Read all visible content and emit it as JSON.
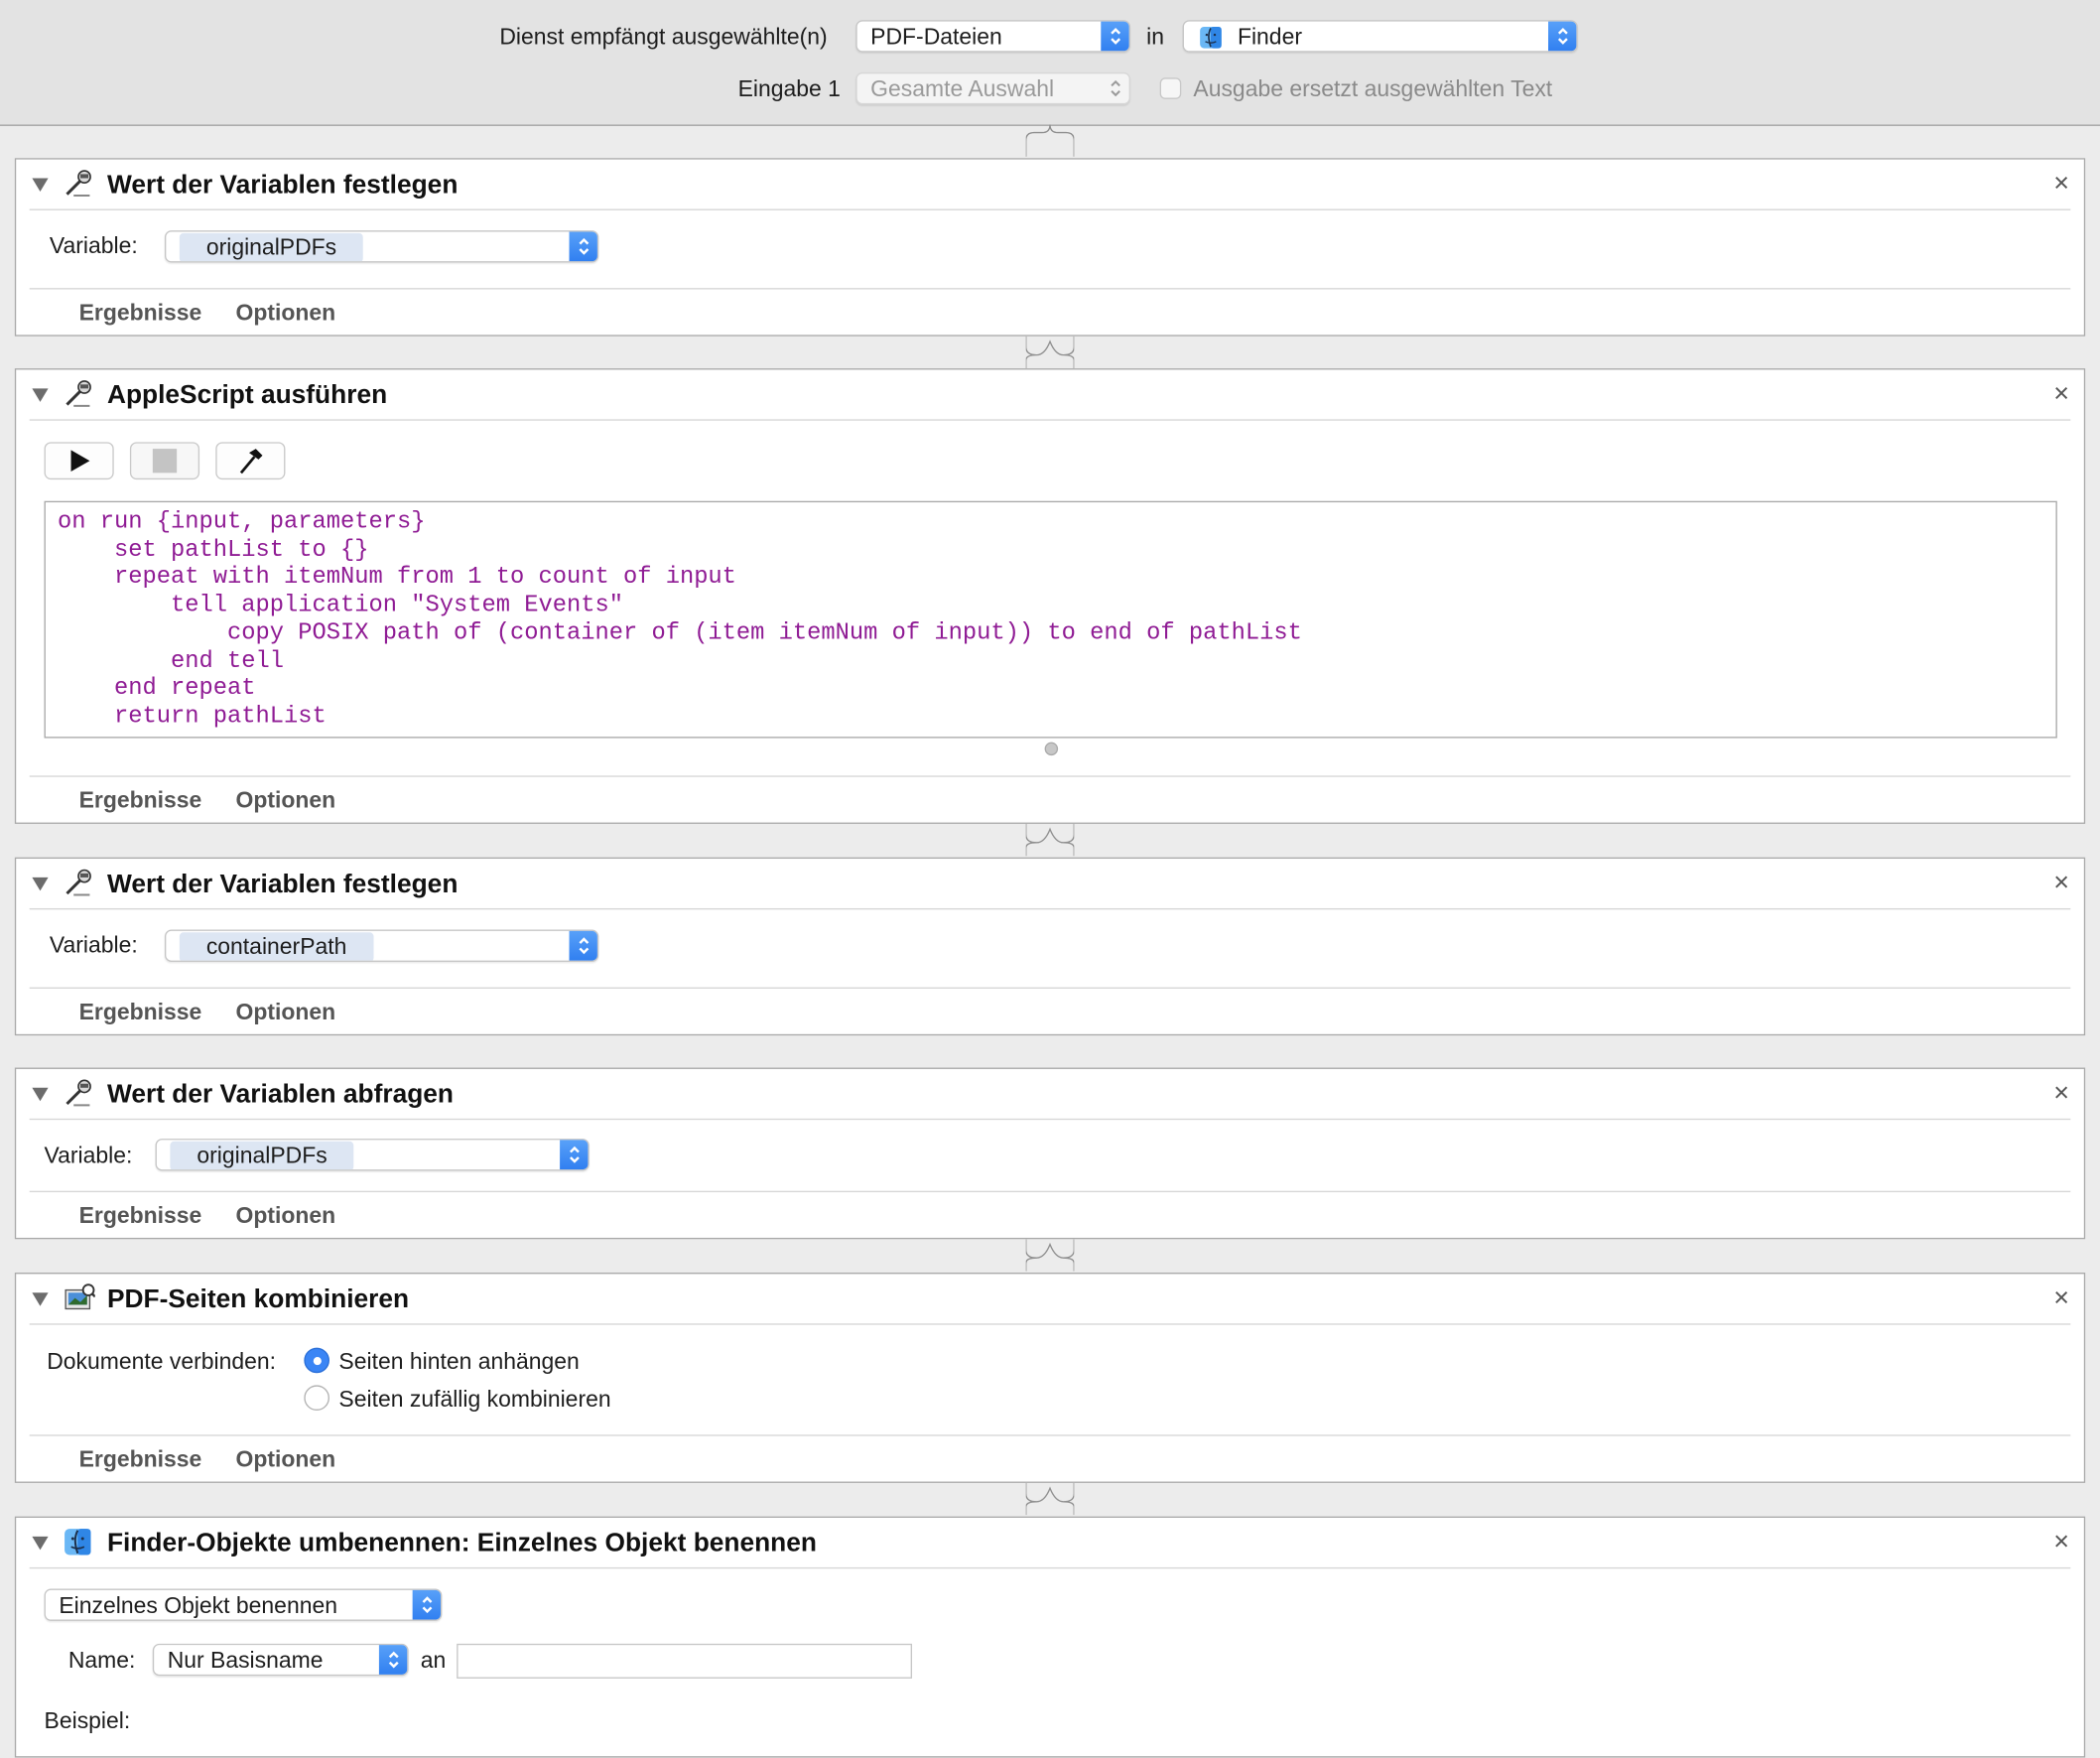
{
  "header": {
    "service_label": "Dienst empfängt ausgewählte(n)",
    "service_value": "PDF-Dateien",
    "in_label": "in",
    "app_value": "Finder",
    "input_label": "Eingabe 1",
    "input_value": "Gesamte Auswahl",
    "replace_label": "Ausgabe ersetzt ausgewählten Text"
  },
  "tabs": {
    "results": "Ergebnisse",
    "options": "Optionen"
  },
  "close_glyph": "×",
  "actions": [
    {
      "title": "Wert der Variablen festlegen",
      "variable_label": "Variable:",
      "variable_value": "originalPDFs"
    },
    {
      "title": "AppleScript ausführen",
      "code": "on run {input, parameters}\n    set pathList to {}\n    repeat with itemNum from 1 to count of input\n        tell application \"System Events\"\n            copy POSIX path of (container of (item itemNum of input)) to end of pathList\n        end tell\n    end repeat\n    return pathList"
    },
    {
      "title": "Wert der Variablen festlegen",
      "variable_label": "Variable:",
      "variable_value": "containerPath"
    },
    {
      "title": "Wert der Variablen abfragen",
      "variable_label": "Variable:",
      "variable_value": "originalPDFs"
    },
    {
      "title": "PDF-Seiten kombinieren",
      "combine_label": "Dokumente verbinden:",
      "options": [
        "Seiten hinten anhängen",
        "Seiten zufällig kombinieren"
      ],
      "selected_index": 0
    },
    {
      "title": "Finder-Objekte umbenennen: Einzelnes Objekt benennen",
      "mode_value": "Einzelnes Objekt benennen",
      "name_label": "Name:",
      "name_value": "Nur Basisname",
      "an_label": "an",
      "example_label": "Beispiel:"
    }
  ],
  "colors": {
    "accent": "#3a85f5",
    "code": "#8f1b94"
  }
}
